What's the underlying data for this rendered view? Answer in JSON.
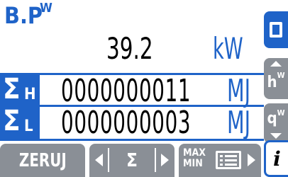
{
  "parameter": {
    "label": "B.P",
    "superscript": "W"
  },
  "reading": {
    "value": "39.2",
    "unit": "kW"
  },
  "energy_rows": [
    {
      "symbol": "Σ",
      "subscript": "H",
      "value": "0000000011",
      "unit": "MJ"
    },
    {
      "symbol": "Σ",
      "subscript": "L",
      "value": "0000000003",
      "unit": "MJ"
    }
  ],
  "side_buttons": {
    "display_mode": {
      "icon": "square-frame-icon",
      "active": true
    },
    "hour_energy": {
      "text": "h",
      "superscript": "W",
      "icon": "arrow-up-icon"
    },
    "energy_prev": {
      "text": "q",
      "superscript": "W",
      "icon": "arrow-down-icon"
    },
    "info": {
      "text": "i"
    }
  },
  "bottom_buttons": {
    "reset": {
      "label": "ZERUJ"
    },
    "sum_nav": {
      "label": "Σ"
    },
    "maxmin": {
      "line1": "MAX",
      "line2": "MIN"
    }
  },
  "colors": {
    "accent": "#1f63c8",
    "button_gray": "#8a8f96",
    "text": "#000000",
    "background": "#ffffff"
  }
}
